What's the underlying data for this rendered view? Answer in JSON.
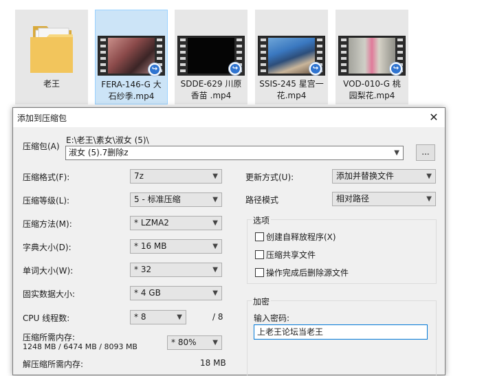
{
  "files": [
    {
      "caption": "老王",
      "kind": "folder"
    },
    {
      "caption": "FERA-146-G 大\n石纱季.mp4",
      "kind": "video",
      "selected": true
    },
    {
      "caption": "SDDE-629 川原\n香苗 .mp4",
      "kind": "video"
    },
    {
      "caption": "SSIS-245 星宫一\n花.mp4",
      "kind": "video"
    },
    {
      "caption": "VOD-010-G 桃\n园梨花.mp4",
      "kind": "video"
    }
  ],
  "dialog": {
    "title": "添加到压缩包",
    "close_glyph": "✕",
    "archive": {
      "label": "压缩包(A)",
      "path": "E:\\老王\\素女\\淑女 (5)\\",
      "name": "淑女 (5).7删除z",
      "browse_label": "..."
    },
    "left": {
      "format": {
        "label": "压缩格式(F):",
        "value": "7z"
      },
      "level": {
        "label": "压缩等级(L):",
        "value": "5 - 标准压缩"
      },
      "method": {
        "label": "压缩方法(M):",
        "value": "* LZMA2"
      },
      "dict": {
        "label": "字典大小(D):",
        "value": "* 16 MB"
      },
      "word": {
        "label": "单词大小(W):",
        "value": "* 32"
      },
      "solid": {
        "label": "固实数据大小:",
        "value": "* 4 GB"
      },
      "threads": {
        "label": "CPU 线程数:",
        "value": "* 8",
        "max": "/ 8"
      },
      "mem_compress": {
        "label": "压缩所需内存:",
        "detail": "1248 MB / 6474 MB / 8093 MB",
        "value": "* 80%"
      },
      "mem_decompress": {
        "label": "解压缩所需内存:",
        "value": "18 MB"
      }
    },
    "right": {
      "update": {
        "label": "更新方式(U):",
        "value": "添加并替换文件"
      },
      "pathmode": {
        "label": "路径模式",
        "value": "相对路径"
      },
      "options": {
        "title": "选项",
        "items": [
          "创建自释放程序(X)",
          "压缩共享文件",
          "操作完成后删除源文件"
        ]
      },
      "encrypt": {
        "title": "加密",
        "password_label": "输入密码:",
        "password_value": "上老王论坛当老王"
      }
    }
  },
  "colors": {
    "accent": "#0078d7",
    "selected_tile": "#cce4f7",
    "dialog_bg": "#f0f0f0"
  }
}
